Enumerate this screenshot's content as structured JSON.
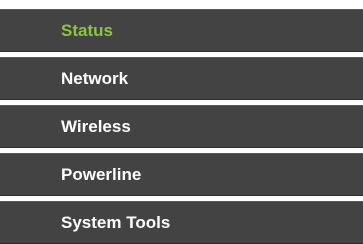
{
  "menu": {
    "items": [
      {
        "label": "Status",
        "active": true
      },
      {
        "label": "Network",
        "active": false
      },
      {
        "label": "Wireless",
        "active": false
      },
      {
        "label": "Powerline",
        "active": false
      },
      {
        "label": "System Tools",
        "active": false
      }
    ],
    "colors": {
      "item_background": "#434343",
      "label_text": "#ffffff",
      "active_text": "#8cc63f",
      "gap": "#ffffff"
    }
  }
}
